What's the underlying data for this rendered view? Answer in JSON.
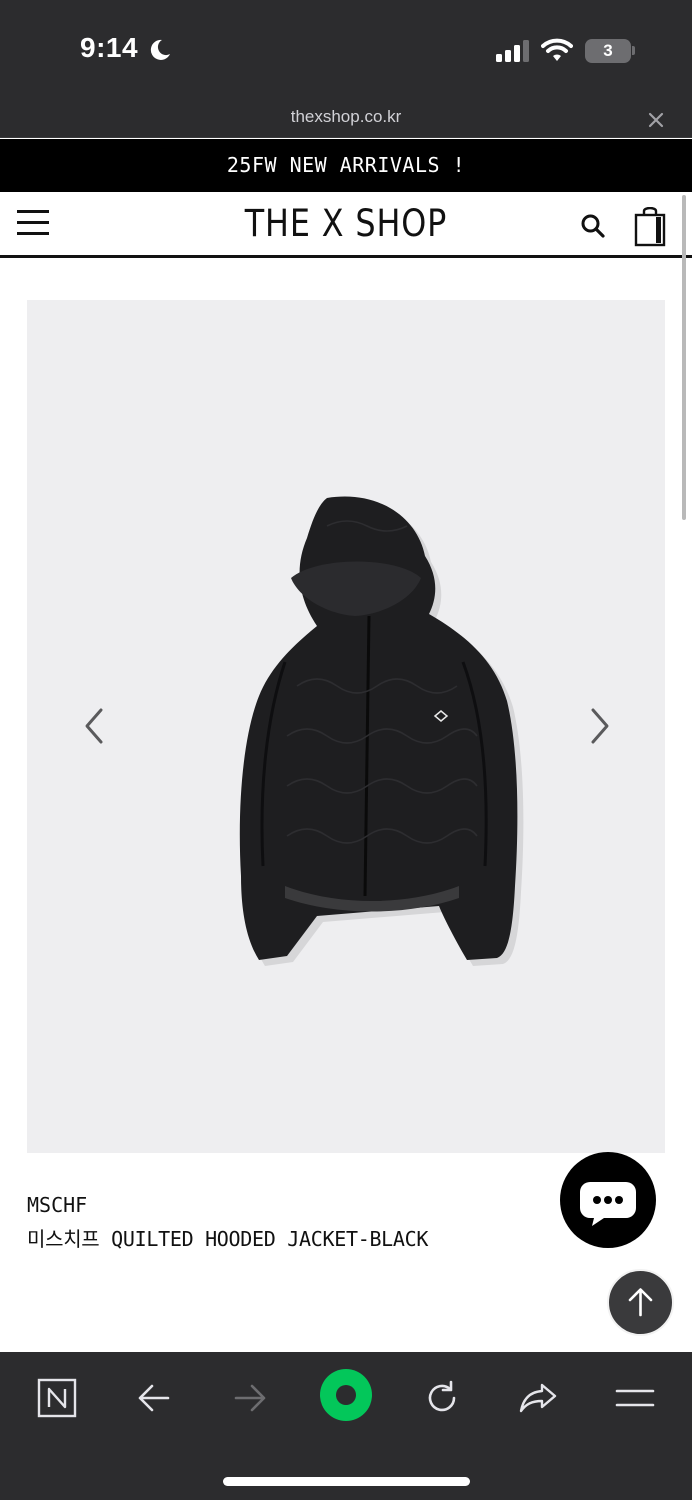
{
  "status_bar": {
    "time": "9:14",
    "battery_level": "3"
  },
  "browser": {
    "url": "thexshop.co.kr"
  },
  "promo_banner": {
    "text": "25FW NEW ARRIVALS !"
  },
  "site_header": {
    "logo": "THE X SHOP"
  },
  "product": {
    "brand": "MSCHF",
    "name": "미스치프 QUILTED HOODED JACKET-BLACK",
    "image_icon": "quilted-hooded-jacket-photo"
  },
  "icons": {
    "menu": "hamburger-menu-icon",
    "search": "search-icon",
    "cart": "shopping-bag-icon",
    "chat": "chat-bubble-icon",
    "scroll_top": "arrow-up-icon"
  },
  "toolbar": {
    "items": [
      "naver-n-icon",
      "back-arrow-icon",
      "forward-arrow-icon",
      "naver-green-dot-icon",
      "reload-icon",
      "share-icon",
      "menu-lines-icon"
    ]
  },
  "colors": {
    "chrome": "#2c2c2e",
    "banner": "#000000",
    "gallery_bg": "#eeeef0",
    "naver_green": "#03c75a"
  }
}
